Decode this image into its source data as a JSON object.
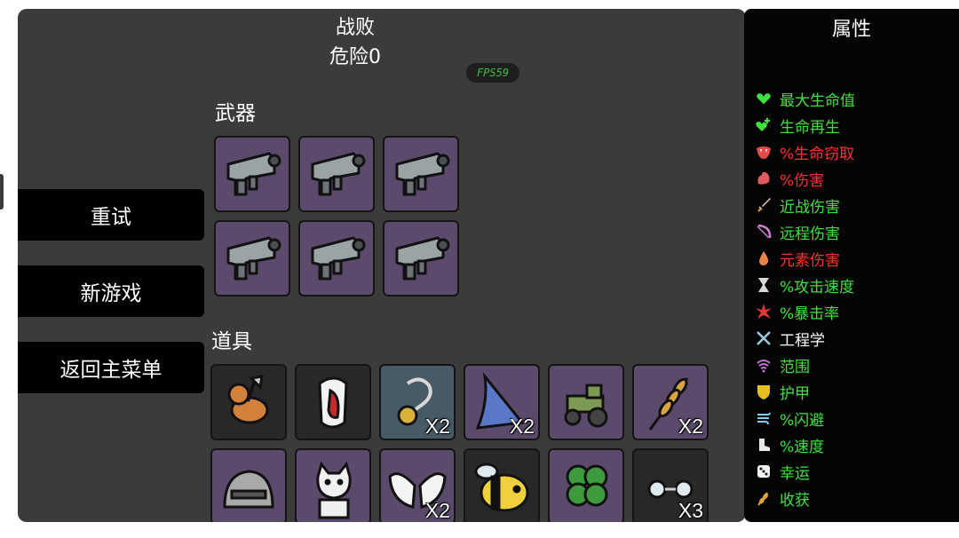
{
  "header": {
    "result": "战败",
    "danger": "危险0",
    "fps": "FPS59"
  },
  "menu": {
    "retry": "重试",
    "new_game": "新游戏",
    "main_menu": "返回主菜单"
  },
  "sections": {
    "weapons": "武器",
    "items": "道具"
  },
  "weapons": [
    {
      "icon": "pistol-icon"
    },
    {
      "icon": "pistol-icon"
    },
    {
      "icon": "pistol-icon"
    },
    {
      "icon": "pistol-icon"
    },
    {
      "icon": "pistol-icon"
    },
    {
      "icon": "pistol-icon"
    }
  ],
  "items": [
    {
      "icon": "lumberjack-teddy-icon",
      "qty": ""
    },
    {
      "icon": "screaming-tooth-icon",
      "qty": ""
    },
    {
      "icon": "amulet-icon",
      "qty": "X2"
    },
    {
      "icon": "shark-fin-icon",
      "qty": "X2"
    },
    {
      "icon": "tractor-icon",
      "qty": ""
    },
    {
      "icon": "wheat-icon",
      "qty": "X2"
    },
    {
      "icon": "knight-helmet-icon",
      "qty": ""
    },
    {
      "icon": "lucky-cat-icon",
      "qty": ""
    },
    {
      "icon": "angel-wings-icon",
      "qty": "X2"
    },
    {
      "icon": "bee-icon",
      "qty": ""
    },
    {
      "icon": "four-leaf-clover-icon",
      "qty": ""
    },
    {
      "icon": "glasses-icon",
      "qty": "X3"
    }
  ],
  "attributes": {
    "title": "属性",
    "stats": [
      {
        "label": "最大生命值",
        "color": "#3ee23e",
        "icon": "heart-icon"
      },
      {
        "label": "生命再生",
        "color": "#3ee23e",
        "icon": "heart-plus-icon"
      },
      {
        "label": "%生命窃取",
        "color": "#ff3030",
        "icon": "vampire-mouth-icon"
      },
      {
        "label": "%伤害",
        "color": "#ff3030",
        "icon": "muscle-icon"
      },
      {
        "label": "近战伤害",
        "color": "#3ee23e",
        "icon": "sword-icon"
      },
      {
        "label": "远程伤害",
        "color": "#3ee23e",
        "icon": "bow-icon"
      },
      {
        "label": "元素伤害",
        "color": "#ff3030",
        "icon": "flame-icon"
      },
      {
        "label": "%攻击速度",
        "color": "#3ee23e",
        "icon": "hourglass-icon"
      },
      {
        "label": "%暴击率",
        "color": "#3ee23e",
        "icon": "crit-burst-icon"
      },
      {
        "label": "工程学",
        "color": "#ffffff",
        "icon": "wrench-cross-icon"
      },
      {
        "label": "范围",
        "color": "#3ee23e",
        "icon": "range-wave-icon"
      },
      {
        "label": "护甲",
        "color": "#3ee23e",
        "icon": "shield-icon"
      },
      {
        "label": "%闪避",
        "color": "#3ee23e",
        "icon": "dodge-wind-icon"
      },
      {
        "label": "%速度",
        "color": "#3ee23e",
        "icon": "boot-icon"
      },
      {
        "label": "幸运",
        "color": "#3ee23e",
        "icon": "dice-icon"
      },
      {
        "label": "收获",
        "color": "#3ee23e",
        "icon": "harvest-icon"
      }
    ]
  }
}
